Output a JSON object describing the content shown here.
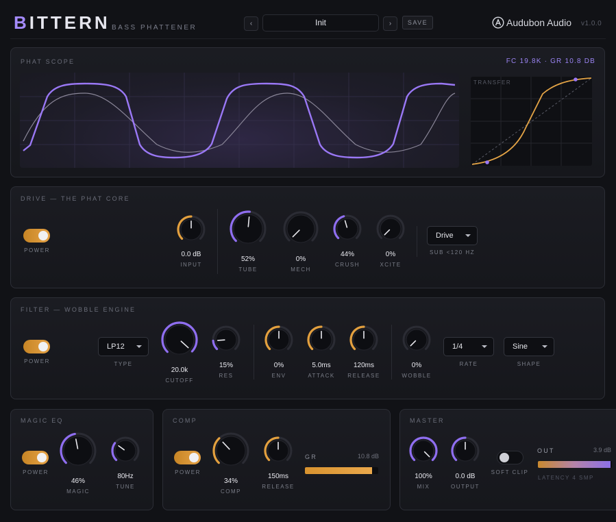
{
  "header": {
    "brand_initial": "B",
    "brand_rest": "ITTERN",
    "subtitle": "BASS PHATTENER",
    "prev_label": "‹",
    "next_label": "›",
    "preset": "Init",
    "save_label": "SAVE",
    "maker": "Audubon Audio",
    "version": "v1.0.0"
  },
  "scope": {
    "title": "PHAT SCOPE",
    "readout": "FC 19.8K · GR 10.8 DB",
    "transfer_label": "TRANSFER"
  },
  "drive": {
    "title": "DRIVE — THE PHAT CORE",
    "power_label": "POWER",
    "power_on": true,
    "knobs": [
      {
        "label": "INPUT",
        "value": "0.0 dB",
        "level": 0.5,
        "color": "orange"
      },
      {
        "label": "TUBE",
        "value": "52%",
        "level": 0.52,
        "color": "purple"
      },
      {
        "label": "MECH",
        "value": "0%",
        "level": 0.0,
        "color": "purple"
      },
      {
        "label": "CRUSH",
        "value": "44%",
        "level": 0.44,
        "color": "purple"
      },
      {
        "label": "XCITE",
        "value": "0%",
        "level": 0.0,
        "color": "purple"
      }
    ],
    "select": {
      "value": "Drive",
      "label": "SUB <120 HZ"
    }
  },
  "filter": {
    "title": "FILTER — WOBBLE ENGINE",
    "power_label": "POWER",
    "power_on": true,
    "type": {
      "value": "LP12",
      "label": "TYPE"
    },
    "knobs": [
      {
        "label": "CUTOFF",
        "value": "20.0k",
        "level": 0.99,
        "color": "purple"
      },
      {
        "label": "RES",
        "value": "15%",
        "level": 0.15,
        "color": "purple"
      },
      {
        "label": "ENV",
        "value": "0%",
        "level": 0.5,
        "color": "orange"
      },
      {
        "label": "ATTACK",
        "value": "5.0ms",
        "level": 0.5,
        "color": "orange"
      },
      {
        "label": "RELEASE",
        "value": "120ms",
        "level": 0.5,
        "color": "orange"
      },
      {
        "label": "WOBBLE",
        "value": "0%",
        "level": 0.0,
        "color": "orange"
      }
    ],
    "rate": {
      "value": "1/4",
      "label": "RATE"
    },
    "shape": {
      "value": "Sine",
      "label": "SHAPE"
    }
  },
  "magic_eq": {
    "title": "MAGIC EQ",
    "power_label": "POWER",
    "power_on": true,
    "knobs": [
      {
        "label": "MAGIC",
        "value": "46%",
        "level": 0.46,
        "color": "purple"
      },
      {
        "label": "TUNE",
        "value": "80Hz",
        "level": 0.3,
        "color": "purple"
      }
    ]
  },
  "comp": {
    "title": "COMP",
    "power_label": "POWER",
    "power_on": true,
    "knobs": [
      {
        "label": "COMP",
        "value": "34%",
        "level": 0.34,
        "color": "orange"
      },
      {
        "label": "RELEASE",
        "value": "150ms",
        "level": 0.5,
        "color": "orange"
      }
    ],
    "gr_label": "GR",
    "gr_value": "10.8 dB",
    "gr_level": 0.92
  },
  "master": {
    "title": "MASTER",
    "knobs": [
      {
        "label": "MIX",
        "value": "100%",
        "level": 1.0,
        "color": "purple"
      },
      {
        "label": "OUTPUT",
        "value": "0.0 dB",
        "level": 0.5,
        "color": "purple"
      }
    ],
    "soft_clip_label": "SOFT CLIP",
    "soft_clip_on": false,
    "out_label": "OUT",
    "out_value": "3.9 dB",
    "out_level": 0.98,
    "latency": "LATENCY 4 SMP"
  },
  "colors": {
    "purple": "#8f6ef0",
    "orange": "#e3a03e",
    "bg": "#111216"
  }
}
